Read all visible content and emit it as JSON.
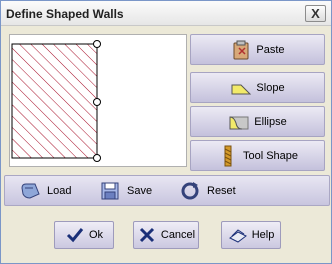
{
  "window": {
    "title": "Define Shaped Walls",
    "close_glyph": "X"
  },
  "side_buttons": [
    {
      "label": "Paste",
      "icon": "paste-icon"
    },
    {
      "label": "Slope",
      "icon": "slope-icon"
    },
    {
      "label": "Ellipse",
      "icon": "ellipse-icon"
    },
    {
      "label": "Tool Shape",
      "icon": "tool-shape-icon"
    }
  ],
  "toolbar": {
    "load": "Load",
    "save": "Save",
    "reset": "Reset"
  },
  "dialog_buttons": {
    "ok": "Ok",
    "cancel": "Cancel",
    "help": "Help"
  },
  "colors": {
    "hatch": "#a8102a",
    "button_top": "#eceaf4",
    "button_bottom": "#c4c1dc"
  }
}
